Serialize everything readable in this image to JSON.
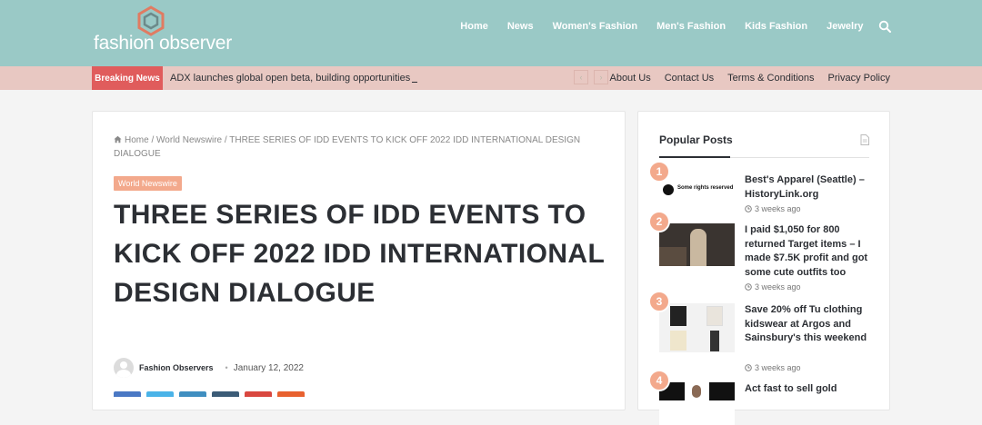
{
  "header": {
    "logo_text": "fashion observer",
    "nav": [
      "Home",
      "News",
      "Women's Fashion",
      "Men's Fashion",
      "Kids Fashion",
      "Jewelry"
    ]
  },
  "topbar": {
    "breaking_label": "Breaking News",
    "breaking_text": "ADX launches global open beta, building opportunities",
    "prev_arrow": "‹",
    "next_arrow": "›",
    "links": [
      "About Us",
      "Contact Us",
      "Terms & Conditions",
      "Privacy Policy"
    ]
  },
  "article": {
    "breadcrumb": {
      "home": "Home",
      "sep": "/",
      "category": "World Newswire",
      "current": "THREE SERIES OF IDD EVENTS TO KICK OFF 2022 IDD INTERNATIONAL DESIGN DIALOGUE"
    },
    "category_badge": "World Newswire",
    "title": "THREE SERIES OF IDD EVENTS TO KICK OFF 2022 IDD INTERNATIONAL DESIGN DIALOGUE",
    "author": "Fashion Observers",
    "date": "January 12, 2022"
  },
  "sidebar": {
    "title": "Popular Posts",
    "posts": [
      {
        "rank": "1",
        "title": "Best's Apparel (Seattle) – HistoryLink.org",
        "date": "3 weeks ago",
        "thumb_text": "Some rights reserved"
      },
      {
        "rank": "2",
        "title": "I paid $1,050 for 800 returned Target items – I made $7.5K profit and got some cute outfits too",
        "date": "3 weeks ago"
      },
      {
        "rank": "3",
        "title": "Save 20% off Tu clothing kidswear at Argos and Sainsbury's this weekend",
        "date": "3 weeks ago"
      },
      {
        "rank": "4",
        "title": "Act fast to sell gold",
        "date": ""
      }
    ]
  },
  "colors": {
    "header_bg": "#9ac9c6",
    "topbar_bg": "#e8c8c2",
    "breaking_bg": "#e05c5c",
    "accent": "#f3a98c",
    "share_colors": [
      "#4a78c4",
      "#4ab3e8",
      "#3f8ec0",
      "#3b5b76",
      "#d9473f",
      "#e8612f"
    ]
  }
}
